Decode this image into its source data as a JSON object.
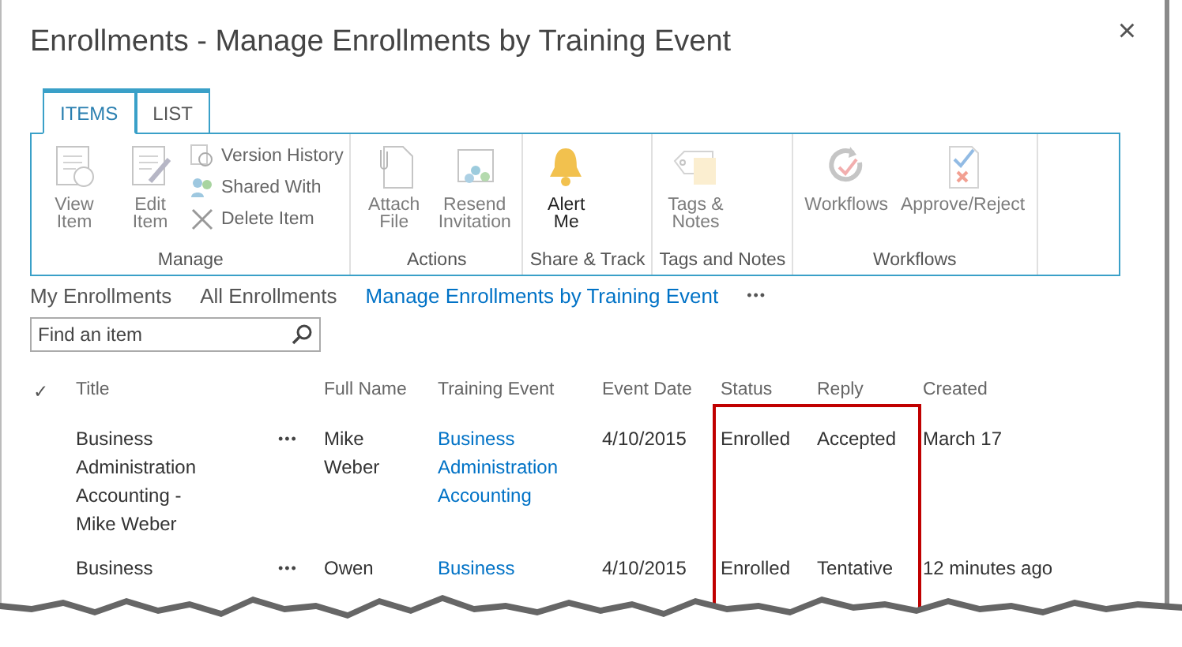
{
  "window": {
    "title": "Enrollments - Manage Enrollments by Training Event",
    "close": "×"
  },
  "ribbon": {
    "tabs": [
      {
        "label": "ITEMS",
        "selected": true
      },
      {
        "label": "LIST",
        "selected": false
      }
    ],
    "groups": [
      {
        "label": "Manage",
        "buttons": [
          {
            "kind": "large",
            "label": "View Item",
            "disabled": true
          },
          {
            "kind": "large",
            "label": "Edit Item",
            "disabled": true
          },
          {
            "kind": "small",
            "label": "Version History",
            "disabled": true
          },
          {
            "kind": "small",
            "label": "Shared With",
            "disabled": true
          },
          {
            "kind": "small",
            "label": "Delete Item",
            "disabled": true
          }
        ]
      },
      {
        "label": "Actions",
        "buttons": [
          {
            "kind": "large",
            "label": "Attach File",
            "disabled": true
          },
          {
            "kind": "large",
            "label": "Resend Invitation",
            "disabled": true
          }
        ]
      },
      {
        "label": "Share & Track",
        "buttons": [
          {
            "kind": "large",
            "label": "Alert Me",
            "disabled": false
          }
        ]
      },
      {
        "label": "Tags and Notes",
        "buttons": [
          {
            "kind": "large",
            "label": "Tags & Notes",
            "disabled": true
          }
        ]
      },
      {
        "label": "Workflows",
        "buttons": [
          {
            "kind": "large",
            "label": "Workflows",
            "disabled": true
          },
          {
            "kind": "large",
            "label": "Approve/Reject",
            "disabled": true
          }
        ]
      }
    ]
  },
  "views": [
    {
      "label": "My Enrollments",
      "selected": false
    },
    {
      "label": "All Enrollments",
      "selected": false
    },
    {
      "label": "Manage Enrollments by Training Event",
      "selected": true
    }
  ],
  "views_more": "•••",
  "search": {
    "placeholder": "Find an item"
  },
  "table": {
    "check": "✓",
    "columns": [
      {
        "label": "Title",
        "highlighted": false
      },
      {
        "label": "Full Name",
        "highlighted": false
      },
      {
        "label": "Training Event",
        "highlighted": false
      },
      {
        "label": "Event Date",
        "highlighted": false
      },
      {
        "label": "Status",
        "highlighted": true
      },
      {
        "label": "Reply",
        "highlighted": true
      },
      {
        "label": "Created",
        "highlighted": false
      }
    ],
    "rows": [
      {
        "title": "Business Administration Accounting - Mike Weber",
        "menu": "•••",
        "full_name": "Mike Weber",
        "training_event": "Business Administration Accounting",
        "event_date": "4/10/2015",
        "status": "Enrolled",
        "reply": "Accepted",
        "created": "March 17"
      },
      {
        "title": "Business",
        "menu": "•••",
        "full_name": "Owen",
        "training_event": "Business",
        "event_date": "4/10/2015",
        "status": "Enrolled",
        "reply": "Tentative",
        "created": "12 minutes ago"
      }
    ]
  }
}
